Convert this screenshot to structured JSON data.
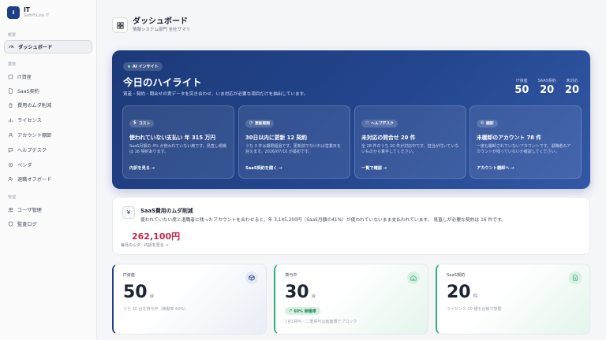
{
  "brand": {
    "logo": "I",
    "name": "IT",
    "sub": "SoftPhLink IT"
  },
  "nav": {
    "section_overview": "概要",
    "section_business": "業務",
    "section_admin": "管理",
    "items": [
      {
        "label": "ダッシュボード",
        "icon": "dashboard-icon"
      },
      {
        "label": "IT資産",
        "icon": "asset-icon"
      },
      {
        "label": "SaaS契約",
        "icon": "document-icon"
      },
      {
        "label": "費用のムダ削減",
        "icon": "trash-icon"
      },
      {
        "label": "ライセンス",
        "icon": "chart-icon"
      },
      {
        "label": "アカウント棚卸",
        "icon": "account-icon"
      },
      {
        "label": "ヘルプデスク",
        "icon": "helpdesk-icon"
      },
      {
        "label": "ベンダ",
        "icon": "vendor-icon"
      },
      {
        "label": "退職オフボード",
        "icon": "offboard-icon"
      },
      {
        "label": "ユーザ管理",
        "icon": "users-icon"
      },
      {
        "label": "監査ログ",
        "icon": "audit-icon"
      }
    ]
  },
  "header": {
    "title": "ダッシュボード",
    "subtitle": "情報システム部門 全社サマリ"
  },
  "hero": {
    "badge": "AI インサイト",
    "title": "今日のハイライト",
    "desc": "資産・契約・問合せの実データを突き合わせ、いま対応が必要な項目だけを抽出しています。",
    "stats": [
      {
        "label": "IT資産",
        "value": "50"
      },
      {
        "label": "SAAS契約",
        "value": "20"
      },
      {
        "label": "未対応",
        "value": "20"
      }
    ],
    "cards": [
      {
        "tag": "コスト",
        "title": "使われていない支払い 年 315 万円",
        "body": "SaaS月額の 4% が使われていない席です。見直し候補は 16 契約あります。",
        "link": "内訳を見る →"
      },
      {
        "tag": "更新期限",
        "title": "30日以内に更新 12 契約",
        "body": "うち 3 件は期限超過です。更新前でなければ営業日を迎えます。2026/07/10 が最初です。",
        "link": "SaaS契約を開く →"
      },
      {
        "tag": "ヘルプデスク",
        "title": "未対応の問合せ 20 件",
        "body": "全 28 件のうち 20 件が対応中です。担当が付いていないものから着手してください。",
        "link": "一覧で確認 →"
      },
      {
        "tag": "棚卸",
        "title": "未棚卸のアカウント 78 件",
        "body": "一度も棚卸されていないアカウントです。退職者のアカウントが残っていないか確認してください。",
        "link": "アカウント棚卸へ →"
      }
    ]
  },
  "saas": {
    "icon": "¥",
    "title": "SaaS費用のムダ削減",
    "desc": "使われていない席と退職者に残ったアカウントを合わせると、年 3,145,200円（SaaS月額の41%）が使われていないまま支払われています。 見直しが必要な契約は 16 件です。",
    "amount": "262,100円",
    "link": "毎月のムダ · 内訳を見る →"
  },
  "kpis": [
    {
      "label": "IT資産",
      "value": "50",
      "unit": "台",
      "note": "うち 30 台を貸与中（稼働率 60%）"
    },
    {
      "label": "貸与中",
      "value": "30",
      "unit": "台",
      "pill": "60% 稼働率",
      "note": "1台1貸与・二重貸与は画面側でブロック"
    },
    {
      "label": "SaaS契約",
      "value": "20",
      "unit": "件",
      "note": "ライセンス 20 種を台帳で管理"
    }
  ],
  "colors": {
    "accent": "#1f3f87",
    "danger": "#c2264a",
    "success": "#2fb07a"
  }
}
